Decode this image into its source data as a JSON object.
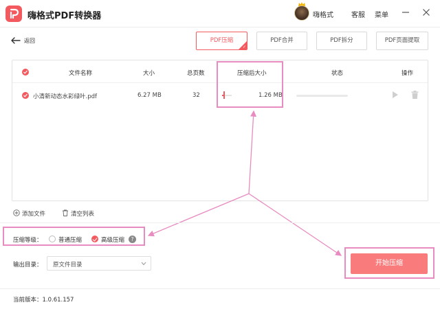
{
  "app": {
    "title": "嗨格式PDF转换器"
  },
  "header": {
    "username": "嗨格式",
    "service_label": "客服",
    "menu_label": "菜单"
  },
  "nav": {
    "back_label": "返回"
  },
  "tabs": [
    {
      "label": "PDF压缩",
      "active": true
    },
    {
      "label": "PDF合并",
      "active": false
    },
    {
      "label": "PDF拆分",
      "active": false
    },
    {
      "label": "PDF页面提取",
      "active": false
    }
  ],
  "table": {
    "headers": {
      "name": "文件名称",
      "size": "大小",
      "pages": "总页数",
      "compressed_size": "压缩后大小",
      "status": "状态",
      "actions": "操作"
    },
    "rows": [
      {
        "name": "小清新动态水彩绿叶.pdf",
        "size": "6.27 MB",
        "pages": "32",
        "compressed_size": "1.26 MB",
        "compression_level_fraction": 0.15,
        "status_progress": 0
      }
    ]
  },
  "actions": {
    "add_file": "添加文件",
    "clear_list": "清空列表"
  },
  "compression": {
    "level_label": "压缩等级：",
    "options": [
      {
        "label": "普通压缩",
        "selected": false
      },
      {
        "label": "高级压缩",
        "selected": true
      }
    ],
    "help_symbol": "?"
  },
  "output": {
    "label": "输出目录：",
    "value": "原文件目录"
  },
  "start_button": "开始压缩",
  "footer": {
    "version": "当前版本：1.0.61.157"
  },
  "colors": {
    "accent": "#f25a5f",
    "start_button": "#f97b7b",
    "highlight": "#e88bc0"
  }
}
